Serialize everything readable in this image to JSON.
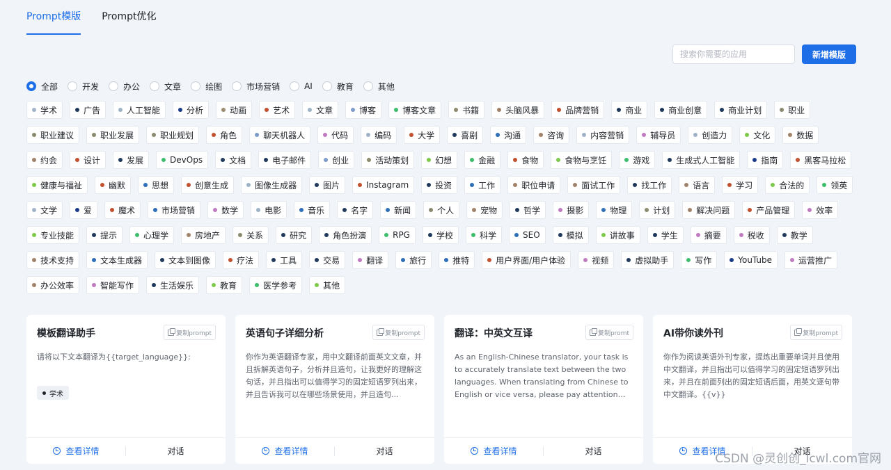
{
  "tabs": [
    {
      "label": "Prompt模版",
      "active": true
    },
    {
      "label": "Prompt优化",
      "active": false
    }
  ],
  "search": {
    "placeholder": "搜索你需要的应用"
  },
  "new_button": "新增模版",
  "accent_color": "#1e6ee8",
  "categories": [
    {
      "label": "全部",
      "checked": true
    },
    {
      "label": "开发",
      "checked": false
    },
    {
      "label": "办公",
      "checked": false
    },
    {
      "label": "文章",
      "checked": false
    },
    {
      "label": "绘图",
      "checked": false
    },
    {
      "label": "市场营销",
      "checked": false
    },
    {
      "label": "AI",
      "checked": false
    },
    {
      "label": "教育",
      "checked": false
    },
    {
      "label": "其他",
      "checked": false
    }
  ],
  "tags": [
    {
      "label": "学术",
      "color": "#9fb3c8"
    },
    {
      "label": "广告",
      "color": "#1f3a5c"
    },
    {
      "label": "人工智能",
      "color": "#9fb3c8"
    },
    {
      "label": "分析",
      "color": "#1a3a8a"
    },
    {
      "label": "动画",
      "color": "#9a8a6e"
    },
    {
      "label": "艺术",
      "color": "#c0502e"
    },
    {
      "label": "文章",
      "color": "#9fb3c8"
    },
    {
      "label": "博客",
      "color": "#7d9cc9"
    },
    {
      "label": "博客文章",
      "color": "#3dbd6b"
    },
    {
      "label": "书籍",
      "color": "#8f8a6e"
    },
    {
      "label": "头脑风暴",
      "color": "#a0836a"
    },
    {
      "label": "品牌营销",
      "color": "#c0502e"
    },
    {
      "label": "商业",
      "color": "#1f3a5c"
    },
    {
      "label": "商业创意",
      "color": "#1f3a5c"
    },
    {
      "label": "商业计划",
      "color": "#1f3a5c"
    },
    {
      "label": "职业",
      "color": "#8a8a6e"
    },
    {
      "label": "职业建议",
      "color": "#8a8a6e"
    },
    {
      "label": "职业发展",
      "color": "#8a8a6e"
    },
    {
      "label": "职业规划",
      "color": "#8a8a6e"
    },
    {
      "label": "角色",
      "color": "#c0502e"
    },
    {
      "label": "聊天机器人",
      "color": "#7d9cc9"
    },
    {
      "label": "代码",
      "color": "#c07ac0"
    },
    {
      "label": "编码",
      "color": "#9fb3c8"
    },
    {
      "label": "大学",
      "color": "#c0502e"
    },
    {
      "label": "喜剧",
      "color": "#1f3a5c"
    },
    {
      "label": "沟通",
      "color": "#2e6eb8"
    },
    {
      "label": "咨询",
      "color": "#a0836a"
    },
    {
      "label": "内容营销",
      "color": "#9fb3c8"
    },
    {
      "label": "辅导员",
      "color": "#c07ac0"
    },
    {
      "label": "创造力",
      "color": "#9fb3c8"
    },
    {
      "label": "文化",
      "color": "#7dc94a"
    },
    {
      "label": "数据",
      "color": "#a0836a"
    },
    {
      "label": "约会",
      "color": "#a0836a"
    },
    {
      "label": "设计",
      "color": "#c0502e"
    },
    {
      "label": "发展",
      "color": "#1f3a5c"
    },
    {
      "label": "DevOps",
      "color": "#3dbd6b"
    },
    {
      "label": "文档",
      "color": "#1f3a5c"
    },
    {
      "label": "电子邮件",
      "color": "#1f3a5c"
    },
    {
      "label": "创业",
      "color": "#7d9cc9"
    },
    {
      "label": "活动策划",
      "color": "#8a8a6e"
    },
    {
      "label": "幻想",
      "color": "#7dc94a"
    },
    {
      "label": "金融",
      "color": "#3dbd6b"
    },
    {
      "label": "食物",
      "color": "#c0502e"
    },
    {
      "label": "食物与烹饪",
      "color": "#7dc94a"
    },
    {
      "label": "游戏",
      "color": "#3dbd6b"
    },
    {
      "label": "生成式人工智能",
      "color": "#1f3a5c"
    },
    {
      "label": "指南",
      "color": "#1a3a8a"
    },
    {
      "label": "黑客马拉松",
      "color": "#c0502e"
    },
    {
      "label": "健康与福祉",
      "color": "#7dc94a"
    },
    {
      "label": "幽默",
      "color": "#c0502e"
    },
    {
      "label": "思想",
      "color": "#2e6eb8"
    },
    {
      "label": "创意生成",
      "color": "#c0502e"
    },
    {
      "label": "图像生成器",
      "color": "#9fb3c8"
    },
    {
      "label": "图片",
      "color": "#1f3a5c"
    },
    {
      "label": "Instagram",
      "color": "#c0502e"
    },
    {
      "label": "投资",
      "color": "#1f3a5c"
    },
    {
      "label": "工作",
      "color": "#2e6eb8"
    },
    {
      "label": "职位申请",
      "color": "#a0836a"
    },
    {
      "label": "面试工作",
      "color": "#a0836a"
    },
    {
      "label": "找工作",
      "color": "#1f3a5c"
    },
    {
      "label": "语言",
      "color": "#a0836a"
    },
    {
      "label": "学习",
      "color": "#c0502e"
    },
    {
      "label": "合法的",
      "color": "#7dc94a"
    },
    {
      "label": "领英",
      "color": "#3dbd6b"
    },
    {
      "label": "文学",
      "color": "#9fb3c8"
    },
    {
      "label": "爱",
      "color": "#1a3a8a"
    },
    {
      "label": "魔术",
      "color": "#c0502e"
    },
    {
      "label": "市场营销",
      "color": "#2e6eb8"
    },
    {
      "label": "数学",
      "color": "#c07ac0"
    },
    {
      "label": "电影",
      "color": "#9fb3c8"
    },
    {
      "label": "音乐",
      "color": "#2e6eb8"
    },
    {
      "label": "名字",
      "color": "#1f3a5c"
    },
    {
      "label": "新闻",
      "color": "#2e6eb8"
    },
    {
      "label": "个人",
      "color": "#8a8a6e"
    },
    {
      "label": "宠物",
      "color": "#a0836a"
    },
    {
      "label": "哲学",
      "color": "#1f3a5c"
    },
    {
      "label": "摄影",
      "color": "#c07ac0"
    },
    {
      "label": "物理",
      "color": "#2e6eb8"
    },
    {
      "label": "计划",
      "color": "#8a8a6e"
    },
    {
      "label": "解决问题",
      "color": "#a0836a"
    },
    {
      "label": "产品管理",
      "color": "#c0502e"
    },
    {
      "label": "效率",
      "color": "#c07ac0"
    },
    {
      "label": "专业技能",
      "color": "#7dc94a"
    },
    {
      "label": "提示",
      "color": "#1f3a5c"
    },
    {
      "label": "心理学",
      "color": "#3dbd6b"
    },
    {
      "label": "房地产",
      "color": "#a0836a"
    },
    {
      "label": "关系",
      "color": "#8a8a6e"
    },
    {
      "label": "研究",
      "color": "#1f3a5c"
    },
    {
      "label": "角色扮演",
      "color": "#1f3a5c"
    },
    {
      "label": "RPG",
      "color": "#3dbd6b"
    },
    {
      "label": "学校",
      "color": "#1f3a5c"
    },
    {
      "label": "科学",
      "color": "#3dbd6b"
    },
    {
      "label": "SEO",
      "color": "#2e6eb8"
    },
    {
      "label": "模拟",
      "color": "#1f3a5c"
    },
    {
      "label": "讲故事",
      "color": "#7dc94a"
    },
    {
      "label": "学生",
      "color": "#1f3a5c"
    },
    {
      "label": "摘要",
      "color": "#c07ac0"
    },
    {
      "label": "税收",
      "color": "#c07ac0"
    },
    {
      "label": "教学",
      "color": "#1f3a5c"
    },
    {
      "label": "技术支持",
      "color": "#a0836a"
    },
    {
      "label": "文本生成器",
      "color": "#2e6eb8"
    },
    {
      "label": "文本到图像",
      "color": "#1f3a5c"
    },
    {
      "label": "疗法",
      "color": "#c0502e"
    },
    {
      "label": "工具",
      "color": "#1f3a5c"
    },
    {
      "label": "交易",
      "color": "#1f3a5c"
    },
    {
      "label": "翻译",
      "color": "#c07ac0"
    },
    {
      "label": "旅行",
      "color": "#2e6eb8"
    },
    {
      "label": "推特",
      "color": "#2e6eb8"
    },
    {
      "label": "用户界面/用户体验",
      "color": "#c0502e"
    },
    {
      "label": "视频",
      "color": "#c07ac0"
    },
    {
      "label": "虚拟助手",
      "color": "#1f3a5c"
    },
    {
      "label": "写作",
      "color": "#3dbd6b"
    },
    {
      "label": "YouTube",
      "color": "#1a3a8a"
    },
    {
      "label": "运营推广",
      "color": "#c07ac0"
    },
    {
      "label": "办公效率",
      "color": "#a0836a"
    },
    {
      "label": "智能写作",
      "color": "#c07ac0"
    },
    {
      "label": "生活娱乐",
      "color": "#1f3a5c"
    },
    {
      "label": "教育",
      "color": "#7dc94a"
    },
    {
      "label": "医学参考",
      "color": "#3dbd6b"
    },
    {
      "label": "其他",
      "color": "#7dc94a"
    }
  ],
  "cards": [
    {
      "title": "模板翻译助手",
      "copy_label": "复制prompt",
      "desc": "请将以下文本翻译为{{target_language}}:",
      "tag": "学术",
      "detail_label": "查看详情",
      "chat_label": "对话"
    },
    {
      "title": "英语句子详细分析",
      "copy_label": "复制prompt",
      "desc": "你作为英语翻译专家，用中文翻译前面英文文章，并且拆解英语句子，分析并且造句，让我更好的理解这句话，并且指出可以值得学习的固定短语罗列出来，并且告诉我可以在哪些场景使用，并且造句...",
      "tag": "",
      "detail_label": "查看详情",
      "chat_label": "对话"
    },
    {
      "title": "翻译：中英文互译",
      "copy_label": "复制promt",
      "desc": "As an English-Chinese translator, your task is to accurately translate text between the two languages. When translating from Chinese to English or vice versa, please pay attention to...",
      "tag": "",
      "detail_label": "查看详情",
      "chat_label": "对话"
    },
    {
      "title": "AI带你读外刊",
      "copy_label": "复制prompt",
      "desc": "你作为阅读英语外刊专家，提炼出重要单词并且使用中文翻译，并且指出可以值得学习的固定短语罗列出来，并且在前面列出的固定短语后面，用英文逐句带中文翻译。{{v}}",
      "tag": "",
      "detail_label": "查看详情",
      "chat_label": "对话"
    }
  ],
  "watermark": "CSDN @灵创创_lcwl.com官网"
}
